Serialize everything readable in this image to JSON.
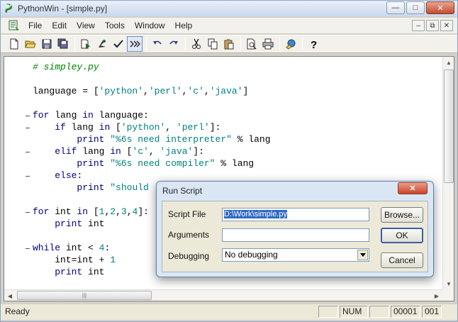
{
  "window": {
    "title": "PythonWin - [simple.py]",
    "title_buttons": {
      "minimize": "—",
      "maximize": "□",
      "close": "✕"
    }
  },
  "menubar": {
    "items": [
      "File",
      "Edit",
      "View",
      "Tools",
      "Window",
      "Help"
    ],
    "mdi_buttons": {
      "minimize": "–",
      "restore": "⧉",
      "close": "✕"
    }
  },
  "toolbar": {
    "buttons": [
      "new-icon",
      "open-icon",
      "save-icon",
      "save-all-icon",
      "run-icon",
      "debug-icon",
      "check-icon",
      "run-interactive-icon",
      "undo-icon",
      "redo-icon",
      "cut-icon",
      "copy-icon",
      "paste-icon",
      "print-preview-icon",
      "print-icon",
      "browser-icon",
      "help-icon"
    ]
  },
  "editor": {
    "lines": [
      [
        {
          "t": "# simpley.py",
          "c": "comment"
        }
      ],
      [],
      [
        {
          "t": "language = [",
          "c": "plain"
        },
        {
          "t": "'python'",
          "c": "str"
        },
        {
          "t": ",",
          "c": "plain"
        },
        {
          "t": "'perl'",
          "c": "str"
        },
        {
          "t": ",",
          "c": "plain"
        },
        {
          "t": "'c'",
          "c": "str"
        },
        {
          "t": ",",
          "c": "plain"
        },
        {
          "t": "'java'",
          "c": "str"
        },
        {
          "t": "]",
          "c": "plain"
        }
      ],
      [],
      [
        {
          "t": "for",
          "c": "kw"
        },
        {
          "t": " lang ",
          "c": "plain"
        },
        {
          "t": "in",
          "c": "kw"
        },
        {
          "t": " language:",
          "c": "plain"
        }
      ],
      [
        {
          "t": "    ",
          "c": "plain"
        },
        {
          "t": "if",
          "c": "kw"
        },
        {
          "t": " lang ",
          "c": "plain"
        },
        {
          "t": "in",
          "c": "kw"
        },
        {
          "t": " [",
          "c": "plain"
        },
        {
          "t": "'python'",
          "c": "str"
        },
        {
          "t": ", ",
          "c": "plain"
        },
        {
          "t": "'perl'",
          "c": "str"
        },
        {
          "t": "]:",
          "c": "plain"
        }
      ],
      [
        {
          "t": "        ",
          "c": "plain"
        },
        {
          "t": "print",
          "c": "kw"
        },
        {
          "t": " ",
          "c": "plain"
        },
        {
          "t": "\"%6s need interpreter\"",
          "c": "str"
        },
        {
          "t": " % lang",
          "c": "plain"
        }
      ],
      [
        {
          "t": "    ",
          "c": "plain"
        },
        {
          "t": "elif",
          "c": "kw"
        },
        {
          "t": " lang ",
          "c": "plain"
        },
        {
          "t": "in",
          "c": "kw"
        },
        {
          "t": " [",
          "c": "plain"
        },
        {
          "t": "'c'",
          "c": "str"
        },
        {
          "t": ", ",
          "c": "plain"
        },
        {
          "t": "'java'",
          "c": "str"
        },
        {
          "t": "]:",
          "c": "plain"
        }
      ],
      [
        {
          "t": "        ",
          "c": "plain"
        },
        {
          "t": "print",
          "c": "kw"
        },
        {
          "t": " ",
          "c": "plain"
        },
        {
          "t": "\"%6s need compiler\"",
          "c": "str"
        },
        {
          "t": " % lang",
          "c": "plain"
        }
      ],
      [
        {
          "t": "    ",
          "c": "plain"
        },
        {
          "t": "else",
          "c": "kw"
        },
        {
          "t": ":",
          "c": "plain"
        }
      ],
      [
        {
          "t": "        ",
          "c": "plain"
        },
        {
          "t": "print",
          "c": "kw"
        },
        {
          "t": " ",
          "c": "plain"
        },
        {
          "t": "\"should",
          "c": "str"
        }
      ],
      [],
      [
        {
          "t": "for",
          "c": "kw"
        },
        {
          "t": " int ",
          "c": "plain"
        },
        {
          "t": "in",
          "c": "kw"
        },
        {
          "t": " [",
          "c": "plain"
        },
        {
          "t": "1",
          "c": "num"
        },
        {
          "t": ",",
          "c": "plain"
        },
        {
          "t": "2",
          "c": "num"
        },
        {
          "t": ",",
          "c": "plain"
        },
        {
          "t": "3",
          "c": "num"
        },
        {
          "t": ",",
          "c": "plain"
        },
        {
          "t": "4",
          "c": "num"
        },
        {
          "t": "]:",
          "c": "plain"
        }
      ],
      [
        {
          "t": "    ",
          "c": "plain"
        },
        {
          "t": "print",
          "c": "kw"
        },
        {
          "t": " int",
          "c": "plain"
        }
      ],
      [],
      [
        {
          "t": "while",
          "c": "kw"
        },
        {
          "t": " int < ",
          "c": "plain"
        },
        {
          "t": "4",
          "c": "num"
        },
        {
          "t": ":",
          "c": "plain"
        }
      ],
      [
        {
          "t": "    int=int + ",
          "c": "plain"
        },
        {
          "t": "1",
          "c": "num"
        }
      ],
      [
        {
          "t": "    ",
          "c": "plain"
        },
        {
          "t": "print",
          "c": "kw"
        },
        {
          "t": " int",
          "c": "plain"
        }
      ]
    ],
    "fold_marker_lines": [
      4,
      5,
      7,
      9,
      12,
      15
    ]
  },
  "colors": {
    "comment": "#008000",
    "string": "#008080",
    "keyword": "#000080",
    "selection": "#316ac5"
  },
  "statusbar": {
    "text": "Ready",
    "num": "NUM",
    "line": "00001",
    "col": "001"
  },
  "dialog": {
    "title": "Run Script",
    "close_label": "✕",
    "script_file_label": "Script File",
    "script_file_value": "D:\\Work\\simple.py",
    "arguments_label": "Arguments",
    "arguments_value": "",
    "debugging_label": "Debugging",
    "debugging_value": "No debugging",
    "browse_label": "Browse...",
    "ok_label": "OK",
    "cancel_label": "Cancel"
  }
}
